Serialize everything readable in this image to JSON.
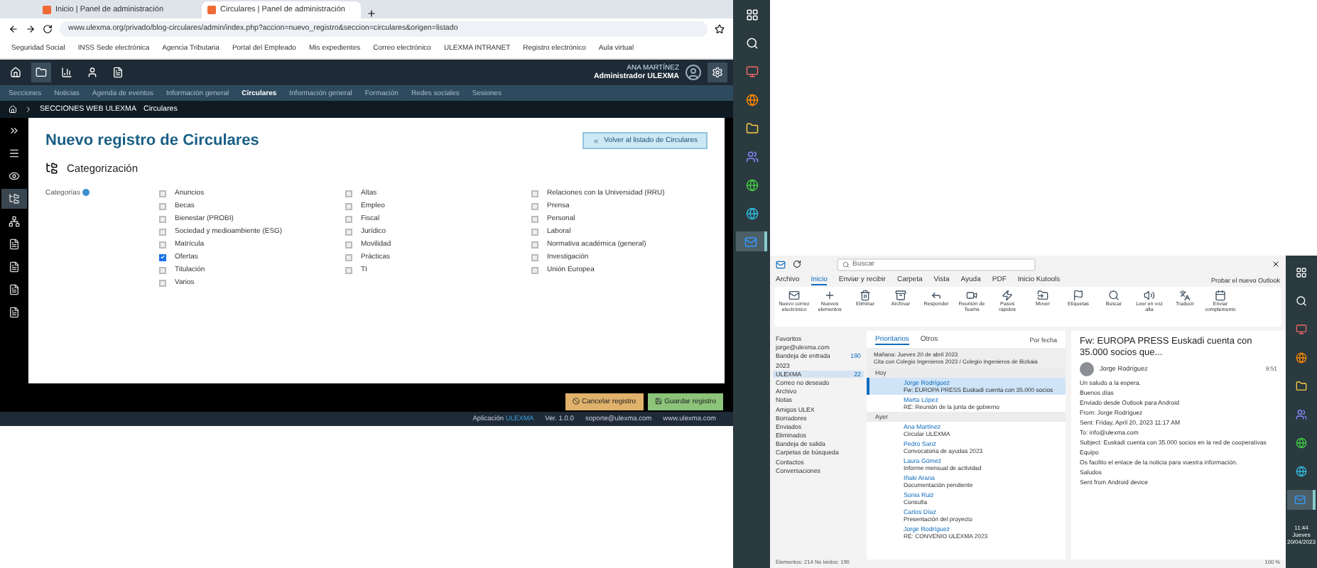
{
  "browser": {
    "tabs": [
      {
        "title": "Inicio | Panel de administración",
        "selected": false
      },
      {
        "title": "Circulares | Panel de administración",
        "selected": true
      }
    ],
    "url": "www.ulexma.org/privado/blog-circulares/admin/index.php?accion=nuevo_registro&seccion=circulares&origen=listado",
    "bookmarks": [
      "Seguridad Social",
      "INSS Sede electrónica",
      "Agencia Tributaria",
      "Portal del Empleado",
      "Mis expedientes",
      "Correo electrónico",
      "ULEXMA INTRANET",
      "Registro electrónico",
      "Aula virtual"
    ]
  },
  "app": {
    "toolbar": [
      {
        "kind": "home",
        "selected": false
      },
      {
        "kind": "folder",
        "selected": true
      },
      {
        "kind": "chart",
        "selected": false
      },
      {
        "kind": "user",
        "selected": false
      },
      {
        "kind": "file",
        "selected": false
      }
    ],
    "user_name": "ANA MARTÍNEZ",
    "user_role": "Administrador ULEXMA",
    "nav": [
      {
        "label": "Secciones",
        "selected": false
      },
      {
        "label": "Noticias",
        "selected": false
      },
      {
        "label": "Agenda de eventos",
        "selected": false
      },
      {
        "label": "Información general",
        "selected": false
      },
      {
        "label": "Circulares",
        "selected": true
      },
      {
        "label": "Información general",
        "selected": false
      },
      {
        "label": "Formación",
        "selected": false
      },
      {
        "label": "Redes sociales",
        "selected": false
      },
      {
        "label": "Sesiones",
        "selected": false
      }
    ],
    "breadcrumb": [
      "SECCIONES WEB ULEXMA",
      "Circulares"
    ],
    "sidebar": [
      {
        "kind": "expand",
        "selected": false
      },
      {
        "kind": "menu",
        "selected": false
      },
      {
        "kind": "eye",
        "selected": false
      },
      {
        "kind": "tree",
        "selected": true
      },
      {
        "kind": "network",
        "selected": false
      },
      {
        "kind": "doc",
        "selected": false
      },
      {
        "kind": "doc",
        "selected": false
      },
      {
        "kind": "doc",
        "selected": false
      },
      {
        "kind": "doc",
        "selected": false
      }
    ],
    "page_title": "Nuevo registro de Circulares",
    "back_button": "Volver al listado de Circulares",
    "section_title": "Categorización",
    "field_label": "Categorías",
    "categories": [
      {
        "items": [
          {
            "label": "Anuncios",
            "checked": false
          },
          {
            "label": "Becas",
            "checked": false
          },
          {
            "label": "Bienestar (PROBI)",
            "checked": false
          },
          {
            "label": "Sociedad y medioambiente (ESG)",
            "checked": false
          },
          {
            "label": "Matrícula",
            "checked": false
          },
          {
            "label": "Ofertas",
            "checked": true
          },
          {
            "label": "Titulación",
            "checked": false
          },
          {
            "label": "Varios",
            "checked": false
          }
        ]
      },
      {
        "items": [
          {
            "label": "Altas",
            "checked": false
          },
          {
            "label": "Empleo",
            "checked": false
          },
          {
            "label": "Fiscal",
            "checked": false
          },
          {
            "label": "Jurídico",
            "checked": false
          },
          {
            "label": "Movilidad",
            "checked": false
          },
          {
            "label": "Prácticas",
            "checked": false
          },
          {
            "label": "TI",
            "checked": false
          }
        ]
      },
      {
        "items": [
          {
            "label": "Relaciones con la Universidad (RRU)",
            "checked": false
          },
          {
            "label": "Prensa",
            "checked": false
          },
          {
            "label": "Personal",
            "checked": false
          },
          {
            "label": "Laboral",
            "checked": false
          },
          {
            "label": "Normativa académica (general)",
            "checked": false
          },
          {
            "label": "Investigación",
            "checked": false
          },
          {
            "label": "Unión Europea",
            "checked": false
          }
        ]
      }
    ],
    "actions": [
      {
        "kind": "cancel",
        "label": "Cancelar registro"
      },
      {
        "kind": "save",
        "label": "Guardar registro"
      }
    ],
    "footer": {
      "prefix": "Aplicación",
      "brand": "ULEXMA",
      "items": [
        "Ver. 1.0.0",
        "soporte@ulexma.com",
        "www.ulexma.com"
      ]
    }
  },
  "taskbar": [
    {
      "kind": "windows",
      "selected": false
    },
    {
      "kind": "search",
      "selected": false
    },
    {
      "kind": "remote",
      "selected": false
    },
    {
      "kind": "firefox",
      "selected": false
    },
    {
      "kind": "explorer",
      "selected": false
    },
    {
      "kind": "teams",
      "selected": false
    },
    {
      "kind": "chrome",
      "selected": false
    },
    {
      "kind": "edge",
      "selected": false
    },
    {
      "kind": "outlook",
      "selected": true
    }
  ],
  "outlook": {
    "search": "Buscar",
    "menu": [
      {
        "label": "Archivo",
        "selected": false
      },
      {
        "label": "Inicio",
        "selected": true
      },
      {
        "label": "Enviar y recibir",
        "selected": false
      },
      {
        "label": "Carpeta",
        "selected": false
      },
      {
        "label": "Vista",
        "selected": false
      },
      {
        "label": "Ayuda",
        "selected": false
      },
      {
        "label": "PDF",
        "selected": false
      },
      {
        "label": "Inicio Kutools",
        "selected": false
      }
    ],
    "new_outlook": "Probar el nuevo Outlook",
    "ribbon": [
      {
        "label": "Nuevo correo electrónico"
      },
      {
        "label": "Nuevos elementos"
      },
      {
        "label": "Eliminar"
      },
      {
        "label": "Archivar"
      },
      {
        "label": "Responder"
      },
      {
        "label": "Reunión de Teams"
      },
      {
        "label": "Pasos rápidos"
      },
      {
        "label": "Mover"
      },
      {
        "label": "Etiquetas"
      },
      {
        "label": "Buscar"
      },
      {
        "label": "Leer en voz alta"
      },
      {
        "label": "Traducir"
      },
      {
        "label": "Enviar complemento"
      }
    ],
    "folders": [
      {
        "label": "Favoritos",
        "selected": false
      },
      {
        "label": "jorge@ulexma.com",
        "selected": false
      },
      {
        "label": "Bandeja de entrada",
        "count": "190",
        "selected": false
      },
      {
        "label": "2023",
        "selected": false
      },
      {
        "label": "ULEXMA",
        "count": "22",
        "selected": true
      },
      {
        "label": "Correo no deseado",
        "selected": false
      },
      {
        "label": "Archivo",
        "selected": false
      },
      {
        "label": "Notas",
        "selected": false
      },
      {
        "label": "Amigos ULEX",
        "selected": false
      },
      {
        "label": "Borradores",
        "selected": false
      },
      {
        "label": "Enviados",
        "selected": false
      },
      {
        "label": "Eliminados",
        "selected": false
      },
      {
        "label": "Bandeja de salida",
        "selected": false
      },
      {
        "label": "Carpetas de búsqueda",
        "selected": false
      },
      {
        "label": "Contactos",
        "selected": false
      },
      {
        "label": "Conversaciones",
        "selected": false
      }
    ],
    "list_tabs": [
      {
        "label": "Prioritarios",
        "selected": true
      },
      {
        "label": "Otros",
        "selected": false
      }
    ],
    "sort": "Por fecha",
    "banner": [
      "Mañana: Jueves 20 de abril 2023",
      "Cita con Colegio Ingenieros 2023 / Colegio Ingenieros de Bizkaia"
    ],
    "groups": [
      {
        "title": "Hoy",
        "messages": [
          {
            "sender": "Jorge Rodríguez",
            "subject": "Fw: EUROPA PRESS Euskadi cuenta con 35.000 socios",
            "selected": true
          },
          {
            "sender": "Marta López",
            "subject": "RE: Reunión de la junta de gobierno",
            "selected": false
          }
        ]
      },
      {
        "title": "Ayer",
        "messages": [
          {
            "sender": "Ana Martínez",
            "subject": "Circular ULEXMA",
            "selected": false
          },
          {
            "sender": "Pedro Sanz",
            "subject": "Convocatoria de ayudas 2023",
            "selected": false
          },
          {
            "sender": "Laura Gómez",
            "subject": "Informe mensual de actividad",
            "selected": false
          },
          {
            "sender": "Iñaki Arana",
            "subject": "Documentación pendiente",
            "selected": false
          },
          {
            "sender": "Sonia Ruiz",
            "subject": "Consulta",
            "selected": false
          },
          {
            "sender": "Carlos Díaz",
            "subject": "Presentación del proyecto",
            "selected": false
          },
          {
            "sender": "Jorge Rodríguez",
            "subject": "RE: CONVENIO ULEXMA 2023",
            "selected": false
          }
        ]
      }
    ],
    "reading": {
      "subject": "Fw: EUROPA PRESS Euskadi cuenta con 35.000 socios que...",
      "sender": "Jorge Rodríguez",
      "date": "9:51",
      "body": [
        "Un saludo a la espera.",
        "Buenos días",
        "Enviado desde Outlook para Android",
        "From: Jorge Rodríguez",
        "Sent: Friday, April 20, 2023 11:17 AM",
        "To: info@ulexma.com",
        "Subject: Euskadi cuenta con 35.000 socios en la red de cooperativas",
        "Equipo",
        "Os facilito el enlace de la noticia para vuestra información.",
        "Saludos",
        "Sent from Android device"
      ]
    },
    "status": "Elementos: 214  No leídos: 190",
    "zoom": "100 %"
  },
  "clock": {
    "time": "11:44",
    "day": "Jueves",
    "date": "20/04/2023"
  }
}
